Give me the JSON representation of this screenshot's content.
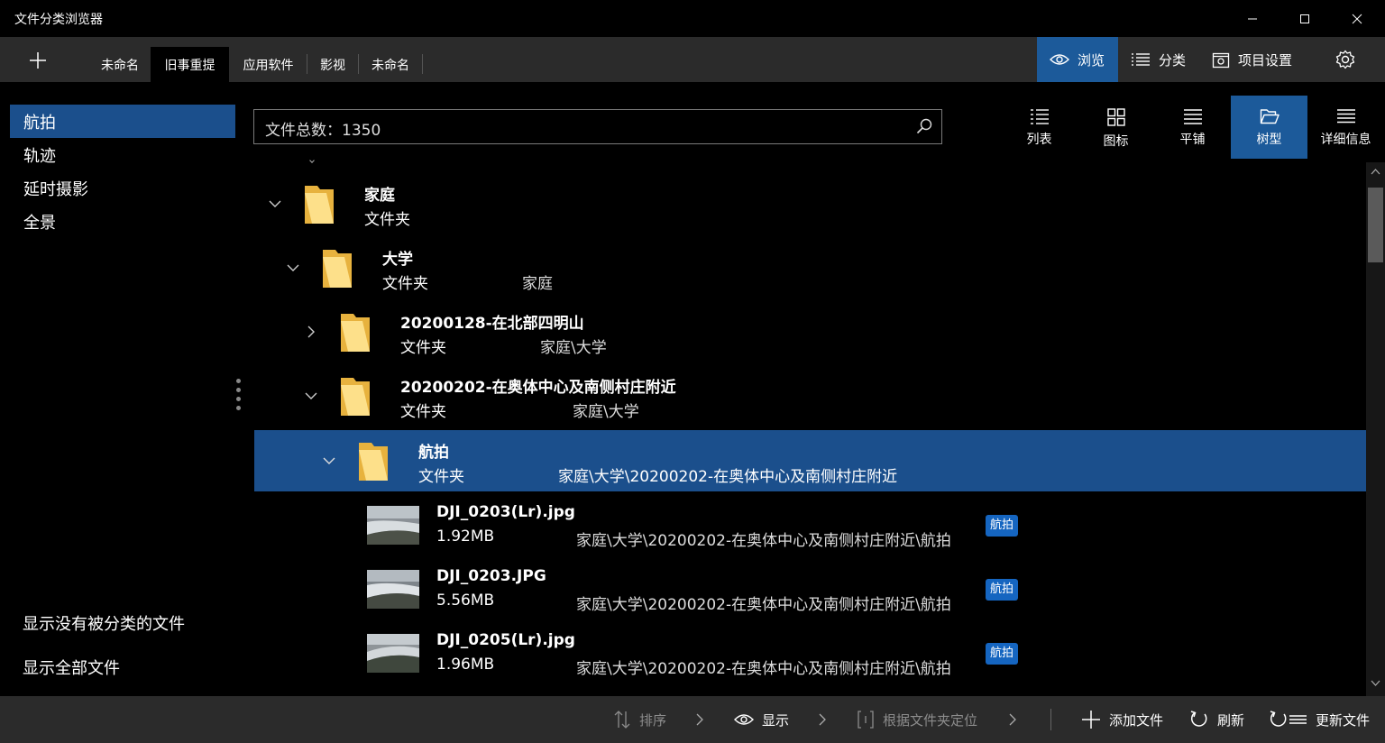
{
  "window": {
    "title": "文件分类浏览器"
  },
  "tabs": [
    {
      "label": "未命名"
    },
    {
      "label": "旧事重提"
    },
    {
      "label": "应用软件"
    },
    {
      "label": "影视"
    },
    {
      "label": "未命名"
    }
  ],
  "modes": {
    "browse": "浏览",
    "classify": "分类",
    "project_settings": "项目设置"
  },
  "sidebar": {
    "categories": [
      {
        "label": "航拍"
      },
      {
        "label": "轨迹"
      },
      {
        "label": "延时摄影"
      },
      {
        "label": "全景"
      }
    ],
    "show_unclassified": "显示没有被分类的文件",
    "show_all": "显示全部文件"
  },
  "search": {
    "value": "文件总数：1350"
  },
  "views": {
    "list": "列表",
    "icons": "图标",
    "tile": "平铺",
    "tree": "树型",
    "details": "详细信息"
  },
  "tree": {
    "folders": [
      {
        "name": "家庭",
        "type": "文件夹",
        "path": ""
      },
      {
        "name": "大学",
        "type": "文件夹",
        "path": "家庭"
      },
      {
        "name": "20200128-在北部四明山",
        "type": "文件夹",
        "path": "家庭\\大学"
      },
      {
        "name": "20200202-在奥体中心及南侧村庄附近",
        "type": "文件夹",
        "path": "家庭\\大学"
      },
      {
        "name": "航拍",
        "type": "文件夹",
        "path": "家庭\\大学\\20200202-在奥体中心及南侧村庄附近"
      }
    ],
    "files": [
      {
        "name": "DJI_0203(Lr).jpg",
        "size": "1.92MB",
        "path": "家庭\\大学\\20200202-在奥体中心及南侧村庄附近\\航拍",
        "tag": "航拍"
      },
      {
        "name": "DJI_0203.JPG",
        "size": "5.56MB",
        "path": "家庭\\大学\\20200202-在奥体中心及南侧村庄附近\\航拍",
        "tag": "航拍"
      },
      {
        "name": "DJI_0205(Lr).jpg",
        "size": "1.96MB",
        "path": "家庭\\大学\\20200202-在奥体中心及南侧村庄附近\\航拍",
        "tag": "航拍"
      }
    ]
  },
  "bottombar": {
    "sort": "排序",
    "display": "显示",
    "locate": "根据文件夹定位",
    "add_file": "添加文件",
    "refresh": "刷新",
    "update_file": "更新文件"
  },
  "colors": {
    "accent": "#1c5a9a",
    "selection": "#1b4f8c",
    "badge": "#1565c0",
    "folder": "#f5c24c"
  }
}
